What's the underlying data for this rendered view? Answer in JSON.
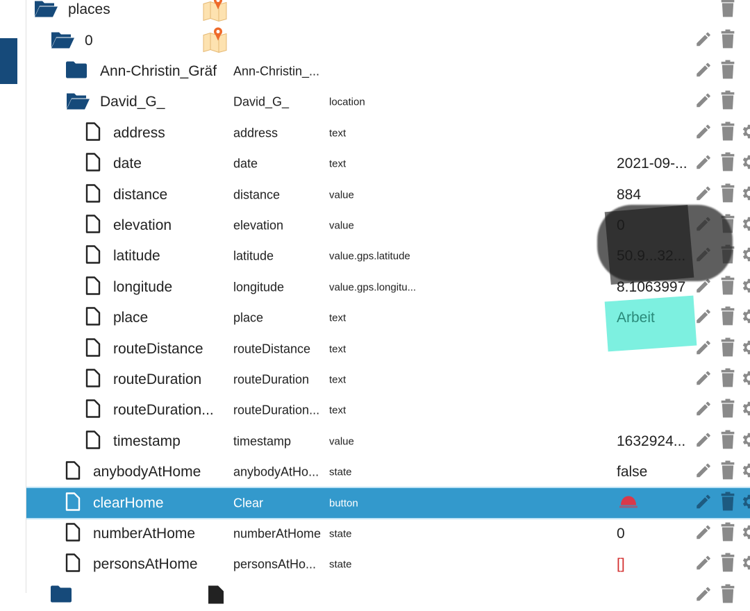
{
  "rows": [
    {
      "name": "places",
      "type": "folder-open",
      "level": 0,
      "map": true
    },
    {
      "name": "0",
      "type": "folder-open",
      "level": 1,
      "map": true
    },
    {
      "name": "Ann-Christin_Gräf",
      "c2": "Ann-Christin_...",
      "type": "folder",
      "level": 2,
      "actions": "edit-delete"
    },
    {
      "name": "David_G_",
      "c2": "David_G_",
      "c3": "location",
      "type": "folder-open",
      "level": 2,
      "actions": "edit-delete"
    },
    {
      "name": "address",
      "c2": "address",
      "c3": "text",
      "type": "file",
      "level": 3
    },
    {
      "name": "date",
      "c2": "date",
      "c3": "text",
      "val": "2021-09-...",
      "type": "file",
      "level": 3
    },
    {
      "name": "distance",
      "c2": "distance",
      "c3": "value",
      "val": "884",
      "type": "file",
      "level": 3
    },
    {
      "name": "elevation",
      "c2": "elevation",
      "c3": "value",
      "val": "0",
      "type": "file",
      "level": 3
    },
    {
      "name": "latitude",
      "c2": "latitude",
      "c3": "value.gps.latitude",
      "val": "50.9...32...",
      "type": "file",
      "level": 3
    },
    {
      "name": "longitude",
      "c2": "longitude",
      "c3": "value.gps.longitu...",
      "val": "8.1063997",
      "type": "file",
      "level": 3
    },
    {
      "name": "place",
      "c2": "place",
      "c3": "text",
      "val": "Arbeit",
      "type": "file",
      "level": 3
    },
    {
      "name": "routeDistance",
      "c2": "routeDistance",
      "c3": "text",
      "type": "file",
      "level": 3
    },
    {
      "name": "routeDuration",
      "c2": "routeDuration",
      "c3": "text",
      "type": "file",
      "level": 3
    },
    {
      "name": "routeDuration...",
      "c2": "routeDuration...",
      "c3": "text",
      "type": "file",
      "level": 3
    },
    {
      "name": "timestamp",
      "c2": "timestamp",
      "c3": "value",
      "val": "1632924...",
      "type": "file",
      "level": 3
    },
    {
      "name": "anybodyAtHome",
      "c2": "anybodyAtHo...",
      "c3": "state",
      "val": "false",
      "type": "file",
      "level": 2
    },
    {
      "name": "clearHome",
      "c2": "Clear",
      "c3": "button",
      "type": "file",
      "level": 2,
      "selected": true,
      "button": true
    },
    {
      "name": "numberAtHome",
      "c2": "numberAtHome",
      "c3": "state",
      "val": "0",
      "type": "file",
      "level": 2
    },
    {
      "name": "personsAtHome",
      "c2": "personsAtHo...",
      "c3": "state",
      "val": "[]",
      "type": "file",
      "level": 2,
      "valColor": "#d32f2f"
    },
    {
      "name": "",
      "type": "folder",
      "level": 1,
      "partial": true
    }
  ],
  "colors": {
    "folder": "#164a7a",
    "selected": "#3399cc",
    "action": "#8a8a8a",
    "bell": "#d9394a"
  }
}
